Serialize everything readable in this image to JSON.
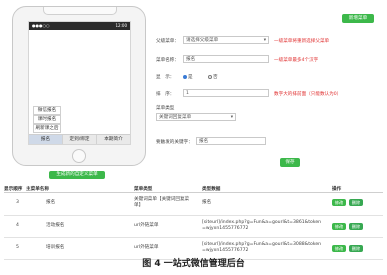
{
  "top_button": "新增菜单",
  "phone": {
    "status_left": "●●●○○",
    "status_right": "12:00",
    "submenu_items": [
      "微信报名",
      "课时报名",
      "刷新课之后"
    ],
    "menubar": [
      "报名",
      "定到/绑定",
      "本期简介"
    ],
    "generate_button": "生成新的自定义菜单"
  },
  "form": {
    "parent_label": "父级菜单：",
    "parent_value": "请选择父级菜单",
    "parent_hint": "一级菜单将重新选择父菜单",
    "name_label": "菜单名称：",
    "name_value": "报名",
    "name_hint": "一级菜单最多4个汉字",
    "show_label": "显　示：",
    "show_yes": "是",
    "show_no": "否",
    "order_label": "排　序：",
    "order_value": "1",
    "order_hint": "数字大的排前面（只能数认为0）",
    "type_label": "菜单类型",
    "type_value": "关键词回复菜单",
    "keyword_label": "要触发的关键字：",
    "keyword_value": "报名",
    "save_button": "保存"
  },
  "table": {
    "headers": [
      "显示顺序",
      "主菜单名称",
      "菜单类型",
      "类型数据",
      "操作"
    ],
    "rows": [
      {
        "order": "3",
        "name": "报名",
        "type": "关键词菜单【关键词回复菜单】",
        "data": "报名",
        "edit": "修改",
        "del": "删除"
      },
      {
        "order": "4",
        "name": "活动报名",
        "type": "url外链菜单",
        "data": "[siteurl]/index.php?g=Fun&a=gourl&t=3861&token=wjyxn1455776772",
        "edit": "修改",
        "del": "删除"
      },
      {
        "order": "5",
        "name": "培训报名",
        "type": "url外链菜单",
        "data": "[siteurl]/index.php?g=Fun&a=gourl&t=3088&token=wjyxn1455776772",
        "edit": "修改",
        "del": "删除"
      }
    ]
  },
  "caption": "图 4   一站式微信管理后台",
  "colors": {
    "accent_green": "#3cb84a",
    "hint_red": "#e03030"
  }
}
